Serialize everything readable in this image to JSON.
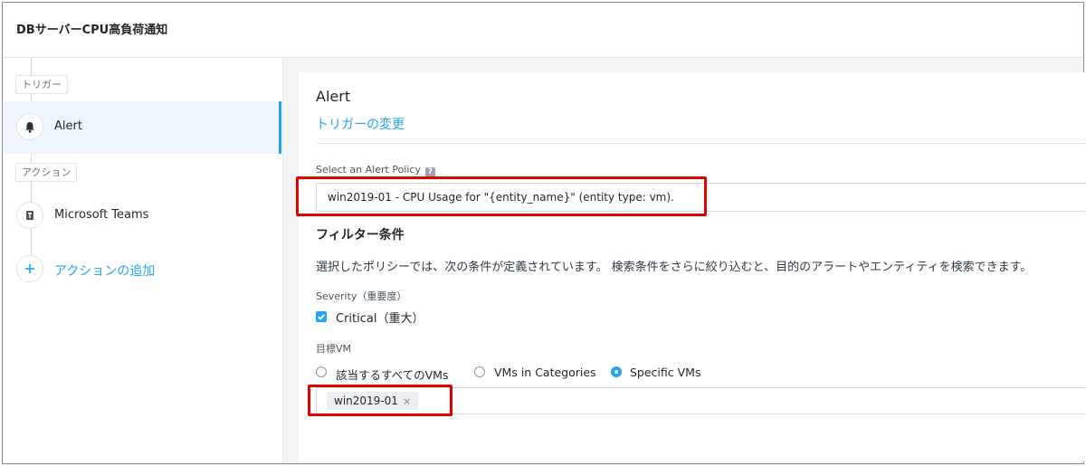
{
  "window": {
    "title": "DBサーバーCPU高負荷通知"
  },
  "sidebar": {
    "trigger_section": "トリガー",
    "trigger_item": "Alert",
    "action_section": "アクション",
    "action_item": "Microsoft Teams",
    "add_action": "アクションの追加"
  },
  "main": {
    "heading": "Alert",
    "change_trigger_link": "トリガーの変更",
    "policy_label": "Select an Alert Policy",
    "policy_value": "win2019-01 - CPU Usage for \"{entity_name}\" (entity type: vm).",
    "filter_title": "フィルター条件",
    "filter_description": "選択したポリシーでは、次の条件が定義されています。 検索条件をさらに絞り込むと、目的のアラートやエンティティを検索できます。",
    "severity_label": "Severity（重要度）",
    "severity_option": "Critical（重大）",
    "target_vm_label": "目標VM",
    "vm_options": [
      "該当するすべてのVMs",
      "VMs in Categories",
      "Specific VMs"
    ],
    "vm_selected_index": 2,
    "vm_chip": "win2019-01",
    "chip_remove": "×"
  },
  "colors": {
    "accent": "#22a5f7",
    "highlight": "#e10000"
  }
}
